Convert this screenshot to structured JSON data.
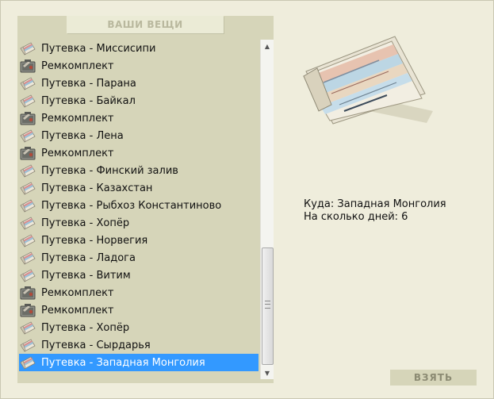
{
  "panel": {
    "title": "ВАШИ ВЕЩИ"
  },
  "items": [
    {
      "label": "Путевка - Миссисипи",
      "icon": "ticket-icon"
    },
    {
      "label": "Ремкомплект",
      "icon": "repair-kit-icon"
    },
    {
      "label": "Путевка - Парана",
      "icon": "ticket-icon"
    },
    {
      "label": "Путевка - Байкал",
      "icon": "ticket-icon"
    },
    {
      "label": "Ремкомплект",
      "icon": "repair-kit-icon"
    },
    {
      "label": "Путевка - Лена",
      "icon": "ticket-icon"
    },
    {
      "label": "Ремкомплект",
      "icon": "repair-kit-icon"
    },
    {
      "label": "Путевка - Финский залив",
      "icon": "ticket-icon"
    },
    {
      "label": "Путевка - Казахстан",
      "icon": "ticket-icon"
    },
    {
      "label": "Путевка - Рыбхоз Константиново",
      "icon": "ticket-icon"
    },
    {
      "label": "Путевка - Хопёр",
      "icon": "ticket-icon"
    },
    {
      "label": "Путевка - Норвегия",
      "icon": "ticket-icon"
    },
    {
      "label": "Путевка - Ладога",
      "icon": "ticket-icon"
    },
    {
      "label": "Путевка - Витим",
      "icon": "ticket-icon"
    },
    {
      "label": "Ремкомплект",
      "icon": "repair-kit-icon"
    },
    {
      "label": "Ремкомплект",
      "icon": "repair-kit-icon"
    },
    {
      "label": "Путевка - Хопёр",
      "icon": "ticket-icon"
    },
    {
      "label": "Путевка - Сырдарья",
      "icon": "ticket-icon"
    },
    {
      "label": "Путевка - Западная Монголия",
      "icon": "ticket-icon",
      "selected": true
    }
  ],
  "details": {
    "destination": "Куда: Западная Монголия",
    "days": "На сколько дней: 6"
  },
  "actions": {
    "take_label": "ВЗЯТЬ"
  },
  "colors": {
    "background": "#efeddc",
    "panel": "#d6d5b9",
    "selection": "#3399ff"
  }
}
